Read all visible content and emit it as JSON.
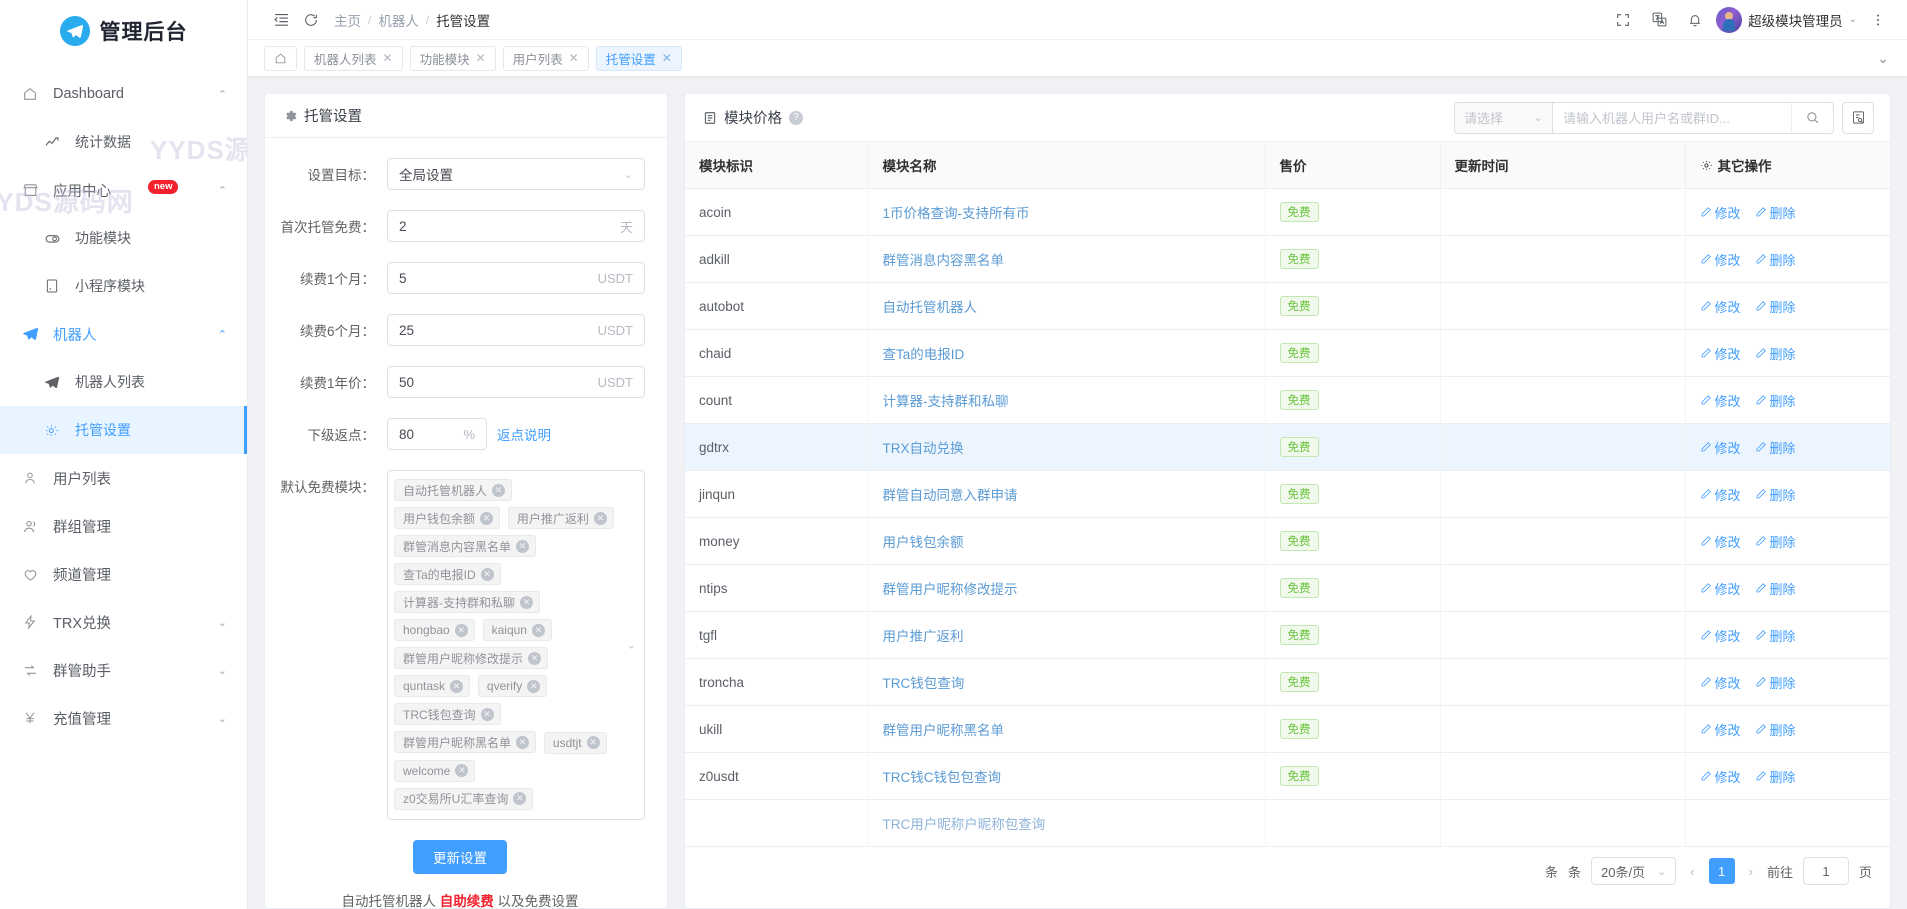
{
  "brand": {
    "title": "管理后台",
    "logo_icon": "telegram-icon",
    "accent": "#2aabee"
  },
  "sidebar": {
    "items": [
      {
        "label": "Dashboard",
        "icon": "home-icon",
        "arrow": "chevron-up-icon",
        "level": "top",
        "state": "open"
      },
      {
        "label": "统计数据",
        "icon": "trend-up-icon",
        "level": "sub",
        "state": "normal"
      },
      {
        "label": "应用中心",
        "icon": "shop-icon",
        "arrow": "chevron-up-icon",
        "level": "top",
        "state": "open",
        "badge": "new"
      },
      {
        "label": "功能模块",
        "icon": "toggle-icon",
        "level": "sub",
        "state": "normal"
      },
      {
        "label": "小程序模块",
        "icon": "miniapp-icon",
        "level": "sub",
        "state": "normal"
      },
      {
        "label": "机器人",
        "icon": "telegram-icon",
        "arrow": "chevron-up-icon",
        "level": "top",
        "state": "group-open"
      },
      {
        "label": "机器人列表",
        "icon": "telegram-icon",
        "level": "sub",
        "state": "normal"
      },
      {
        "label": "托管设置",
        "icon": "gear-icon",
        "level": "sub",
        "state": "active"
      },
      {
        "label": "用户列表",
        "icon": "user-icon",
        "level": "top",
        "state": "normal"
      },
      {
        "label": "群组管理",
        "icon": "users-icon",
        "level": "top",
        "state": "normal"
      },
      {
        "label": "频道管理",
        "icon": "heart-icon",
        "level": "top",
        "state": "normal"
      },
      {
        "label": "TRX兑换",
        "icon": "bolt-icon",
        "arrow": "chevron-down-icon",
        "level": "top",
        "state": "normal"
      },
      {
        "label": "群管助手",
        "icon": "swap-icon",
        "arrow": "chevron-down-icon",
        "level": "top",
        "state": "normal"
      },
      {
        "label": "充值管理",
        "icon": "yen-icon",
        "arrow": "chevron-down-icon",
        "level": "top",
        "state": "normal"
      }
    ],
    "watermark_1": "YYDS源码网",
    "watermark_2": "YYDS源码网"
  },
  "topbar": {
    "collapse_icon": "menu-fold-icon",
    "refresh_icon": "refresh-icon",
    "breadcrumb": [
      "主页",
      "机器人",
      "托管设置"
    ],
    "breadcrumb_sep": "/",
    "fullscreen_icon": "fullscreen-icon",
    "translate_icon": "translate-icon",
    "bell_icon": "bell-icon",
    "user_name": "超级模块管理员",
    "user_caret": "chevron-down-icon",
    "more_icon": "more-vertical-icon"
  },
  "tabs": {
    "home_icon": "home-icon",
    "items": [
      {
        "label": "机器人列表",
        "active": false
      },
      {
        "label": "功能模块",
        "active": false
      },
      {
        "label": "用户列表",
        "active": false
      },
      {
        "label": "托管设置",
        "active": true
      }
    ],
    "close_icon": "close-icon",
    "dropdown_icon": "chevron-down-icon"
  },
  "left_panel": {
    "icon": "gear-icon",
    "title": "托管设置",
    "fields": [
      {
        "label": "设置目标：",
        "type": "select",
        "value": "全局设置",
        "suffix": ""
      },
      {
        "label": "首次托管免费：",
        "type": "input",
        "value": "2",
        "suffix": "天"
      },
      {
        "label": "续费1个月：",
        "type": "input",
        "value": "5",
        "suffix": "USDT"
      },
      {
        "label": "续费6个月：",
        "type": "input",
        "value": "25",
        "suffix": "USDT"
      },
      {
        "label": "续费1年价：",
        "type": "input",
        "value": "50",
        "suffix": "USDT"
      }
    ],
    "rebate": {
      "label": "下级返点：",
      "value": "80",
      "suffix": "%",
      "link": "返点说明"
    },
    "modules_label": "默认免费模块：",
    "module_tags": [
      "自动托管机器人",
      "用户钱包余额",
      "用户推广返利",
      "群管消息内容黑名单",
      "查Ta的电报ID",
      "计算器-支持群和私聊",
      "hongbao",
      "kaiqun",
      "群管用户昵称修改提示",
      "quntask",
      "qverify",
      "TRC钱包查询",
      "群管用户昵称黑名单",
      "usdtjt",
      "welcome",
      "z0交易所U汇率查询"
    ],
    "tag_remove_icon": "close-circle-icon",
    "tagbox_chevron": "chevron-down-icon",
    "submit_label": "更新设置",
    "footer_note_pre": "自动托管机器人 ",
    "footer_note_hot": "自助续费",
    "footer_note_post": " 以及免费设置"
  },
  "right_panel": {
    "icon": "list-icon",
    "title": "模块价格",
    "help_icon": "question-icon",
    "filter": {
      "placeholder": "请选择",
      "chevron": "chevron-down-icon"
    },
    "search": {
      "placeholder": "请输入机器人用户名或群ID...",
      "value": "",
      "icon": "search-icon"
    },
    "export_icon": "export-icon",
    "table": {
      "columns": [
        "模块标识",
        "模块名称",
        "售价",
        "更新时间",
        "其它操作"
      ],
      "ops_header_icon": "gear-icon",
      "edit_icon": "edit-icon",
      "delete_icon": "edit-icon",
      "edit_label": "修改",
      "delete_label": "删除",
      "price_badge": "免费",
      "rows": [
        {
          "id": "acoin",
          "name": "1币价格查询-支持所有币",
          "price": "免费",
          "updated": "",
          "hovered": false
        },
        {
          "id": "adkill",
          "name": "群管消息内容黑名单",
          "price": "免费",
          "updated": "",
          "hovered": false
        },
        {
          "id": "autobot",
          "name": "自动托管机器人",
          "price": "免费",
          "updated": "",
          "hovered": false
        },
        {
          "id": "chaid",
          "name": "查Ta的电报ID",
          "price": "免费",
          "updated": "",
          "hovered": false
        },
        {
          "id": "count",
          "name": "计算器-支持群和私聊",
          "price": "免费",
          "updated": "",
          "hovered": false
        },
        {
          "id": "gdtrx",
          "name": "TRX自动兑换",
          "price": "免费",
          "updated": "",
          "hovered": true
        },
        {
          "id": "jinqun",
          "name": "群管自动同意入群申请",
          "price": "免费",
          "updated": "",
          "hovered": false
        },
        {
          "id": "money",
          "name": "用户钱包余额",
          "price": "免费",
          "updated": "",
          "hovered": false
        },
        {
          "id": "ntips",
          "name": "群管用户昵称修改提示",
          "price": "免费",
          "updated": "",
          "hovered": false
        },
        {
          "id": "tgfl",
          "name": "用户推广返利",
          "price": "免费",
          "updated": "",
          "hovered": false
        },
        {
          "id": "troncha",
          "name": "TRC钱包查询",
          "price": "免费",
          "updated": "",
          "hovered": false
        },
        {
          "id": "ukill",
          "name": "群管用户昵称黑名单",
          "price": "免费",
          "updated": "",
          "hovered": false
        },
        {
          "id": "z0usdt",
          "name": "TRC钱C钱包包查询",
          "price": "免费",
          "updated": "",
          "hovered": false
        }
      ],
      "partial_row_name": "TRC用户昵称户昵称包查询"
    },
    "pagination": {
      "unit_1": "条",
      "unit_2": "条",
      "page_size": "20条/页",
      "page_size_chevron": "chevron-down-icon",
      "prev_icon": "chevron-left-icon",
      "next_icon": "chevron-right-icon",
      "current_page": "1",
      "goto_label": "前往",
      "goto_value": "1",
      "goto_unit": "页"
    }
  }
}
